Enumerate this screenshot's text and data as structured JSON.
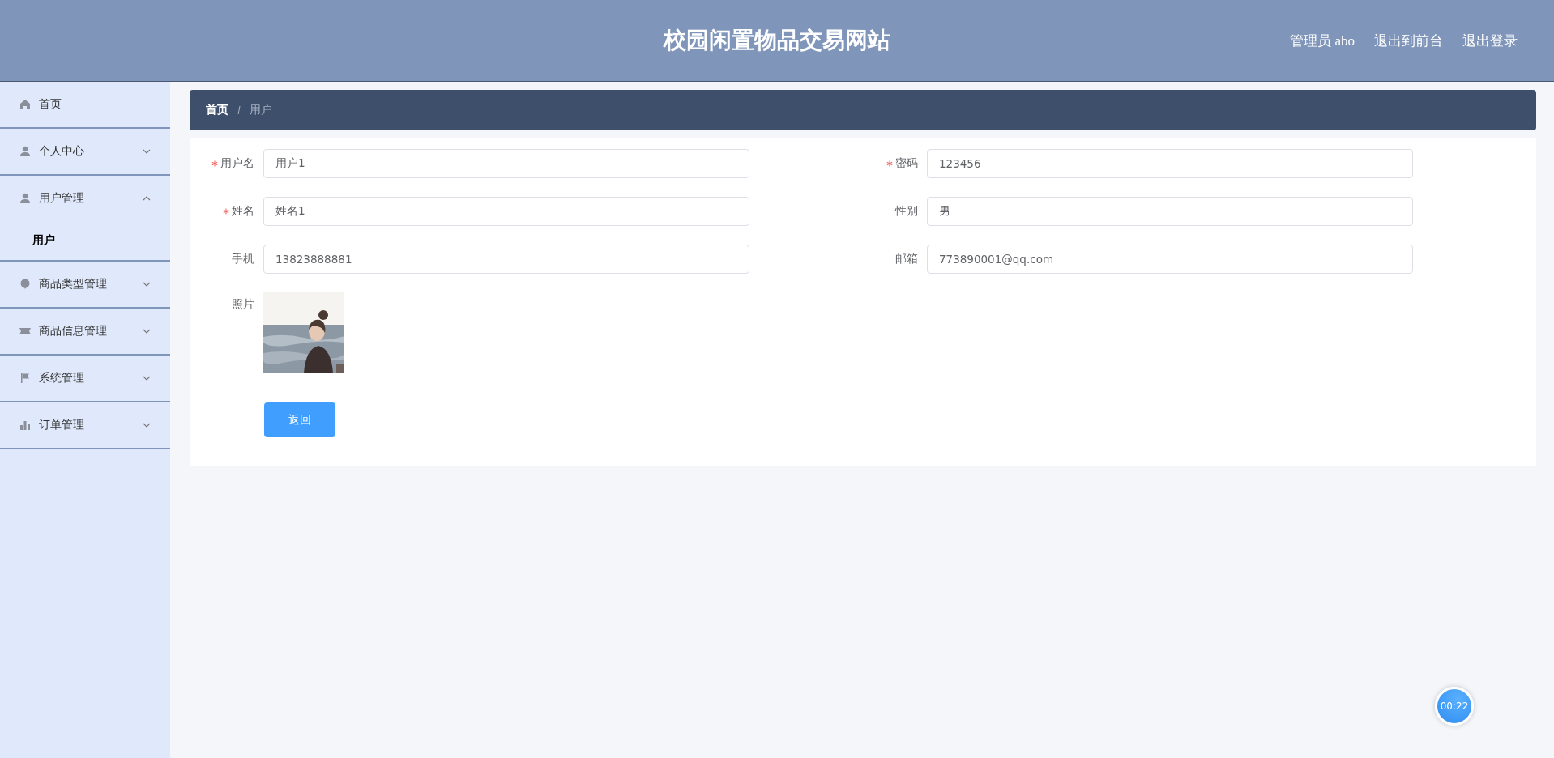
{
  "header": {
    "title": "校园闲置物品交易网站",
    "links": [
      "管理员 abo",
      "退出到前台",
      "退出登录"
    ]
  },
  "sidebar": {
    "items": [
      {
        "label": "首页",
        "kind": "link"
      },
      {
        "label": "个人中心",
        "kind": "menu",
        "expanded": false
      },
      {
        "label": "用户管理",
        "kind": "menu",
        "expanded": true,
        "children": [
          {
            "label": "用户"
          }
        ]
      },
      {
        "label": "商品类型管理",
        "kind": "menu",
        "expanded": false
      },
      {
        "label": "商品信息管理",
        "kind": "menu",
        "expanded": false
      },
      {
        "label": "系统管理",
        "kind": "menu",
        "expanded": false
      },
      {
        "label": "订单管理",
        "kind": "menu",
        "expanded": false
      }
    ]
  },
  "breadcrumb": [
    "首页",
    "用户"
  ],
  "form": {
    "fields": [
      {
        "label": "用户名",
        "value": "用户1",
        "required": true
      },
      {
        "label": "密码",
        "value": "123456",
        "required": true
      },
      {
        "label": "姓名",
        "value": "姓名1",
        "required": true
      },
      {
        "label": "性别",
        "value": "男",
        "required": false
      },
      {
        "label": "手机",
        "value": "13823888881",
        "required": false
      },
      {
        "label": "邮箱",
        "value": "773890001@qq.com",
        "required": false
      }
    ],
    "photo": {
      "label": "照片",
      "kind": "picture"
    },
    "button": "返回"
  },
  "timer": "00:22"
}
